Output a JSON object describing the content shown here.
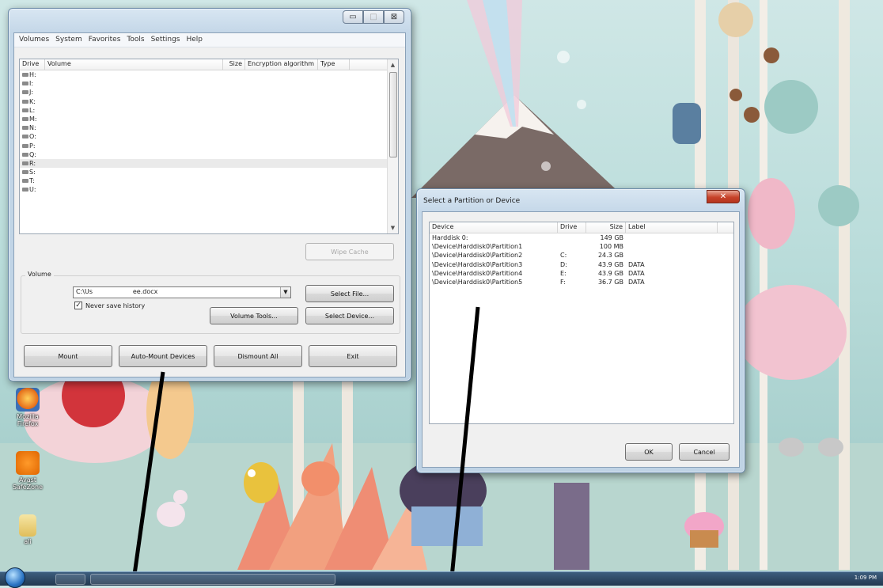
{
  "truecrypt_window": {
    "menu": [
      "Volumes",
      "System",
      "Favorites",
      "Tools",
      "Settings",
      "Help"
    ],
    "drive_list": {
      "columns": [
        "Drive",
        "Volume",
        "Size",
        "Encryption algorithm",
        "Type"
      ],
      "rows": [
        "H:",
        "I:",
        "J:",
        "K:",
        "L:",
        "M:",
        "N:",
        "O:",
        "P:",
        "Q:",
        "R:",
        "S:",
        "T:",
        "U:"
      ],
      "selected_row": "R:"
    },
    "wipe_cache_label": "Wipe Cache",
    "volume_group_label": "Volume",
    "volume_path": "C:\\Us                    ee.docx",
    "never_save_history_label": "Never save history",
    "never_save_history_checked": true,
    "select_file_label": "Select File...",
    "volume_tools_label": "Volume Tools...",
    "select_device_label": "Select Device...",
    "mount_label": "Mount",
    "auto_mount_label": "Auto-Mount Devices",
    "dismount_all_label": "Dismount All",
    "exit_label": "Exit"
  },
  "partition_dialog": {
    "title": "Select a Partition or Device",
    "columns": [
      "Device",
      "Drive",
      "Size",
      "Label"
    ],
    "rows": [
      {
        "device": "Harddisk 0:",
        "drive": "",
        "size": "149 GB",
        "label": ""
      },
      {
        "device": "\\Device\\Harddisk0\\Partition1",
        "drive": "",
        "size": "100 MB",
        "label": ""
      },
      {
        "device": "\\Device\\Harddisk0\\Partition2",
        "drive": "C:",
        "size": "24.3 GB",
        "label": ""
      },
      {
        "device": "\\Device\\Harddisk0\\Partition3",
        "drive": "D:",
        "size": "43.9 GB",
        "label": "DATA"
      },
      {
        "device": "\\Device\\Harddisk0\\Partition4",
        "drive": "E:",
        "size": "43.9 GB",
        "label": "DATA"
      },
      {
        "device": "\\Device\\Harddisk0\\Partition5",
        "drive": "F:",
        "size": "36.7 GB",
        "label": "DATA"
      }
    ],
    "ok_label": "OK",
    "cancel_label": "Cancel"
  },
  "desktop_icons": [
    {
      "name": "Mozilla Firefox",
      "icon": "firefox-icon"
    },
    {
      "name": "Avast SafeZone",
      "icon": "avast-icon"
    },
    {
      "name": "ali",
      "icon": "folder-icon"
    }
  ],
  "taskbar": {
    "clock": "1:09 PM"
  },
  "colors": {
    "window_frame": "#c4d7e8",
    "close_button": "#c7432a",
    "dialog_background": "#f0f0f0"
  }
}
